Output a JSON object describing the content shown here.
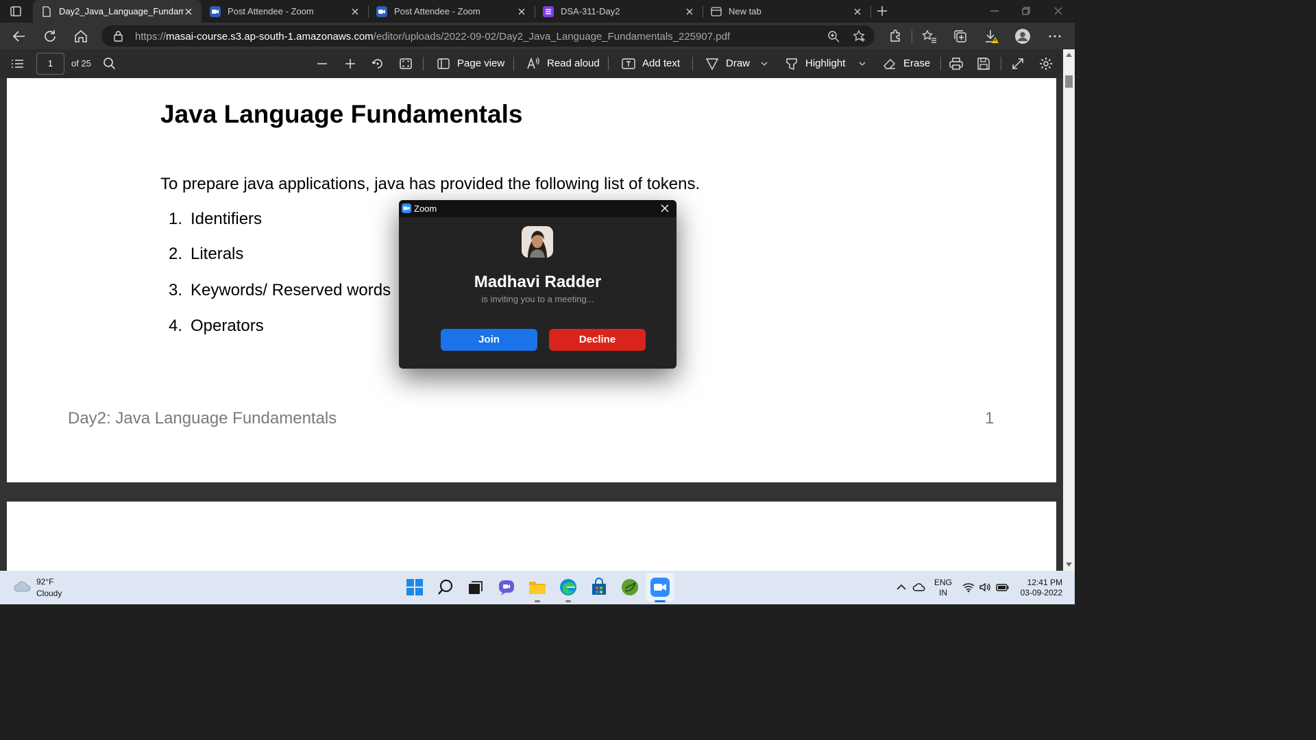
{
  "browser": {
    "tabs": [
      {
        "title": "Day2_Java_Language_Fundamentals_225907.pdf",
        "active": true,
        "icon": "document-icon"
      },
      {
        "title": "Post Attendee - Zoom",
        "active": false,
        "icon": "zoom-icon"
      },
      {
        "title": "Post Attendee - Zoom",
        "active": false,
        "icon": "zoom-icon"
      },
      {
        "title": "DSA-311-Day2",
        "active": false,
        "icon": "list-icon"
      },
      {
        "title": "New tab",
        "active": false,
        "icon": "newtab-icon"
      }
    ],
    "url_prefix": "https://",
    "url_host": "masai-course.s3.ap-south-1.amazonaws.com",
    "url_path": "/editor/uploads/2022-09-02/Day2_Java_Language_Fundamentals_225907.pdf"
  },
  "pdf_toolbar": {
    "page_number": "1",
    "page_total": "of 25",
    "page_view": "Page view",
    "read_aloud": "Read aloud",
    "add_text": "Add text",
    "draw": "Draw",
    "highlight": "Highlight",
    "erase": "Erase"
  },
  "document": {
    "title": "Java Language Fundamentals",
    "intro": "To prepare java applications, java has provided the following list of tokens.",
    "list": [
      {
        "num": "1.",
        "text": "Identifiers"
      },
      {
        "num": "2.",
        "text": "Literals"
      },
      {
        "num": "3.",
        "text": "Keywords/ Reserved words"
      },
      {
        "num": "4.",
        "text": "Operators"
      }
    ],
    "footer_title": "Day2: Java Language Fundamentals",
    "footer_page": "1"
  },
  "zoom_dialog": {
    "title": "Zoom",
    "caller_name": "Madhavi Radder",
    "message": "is inviting you to a meeting...",
    "join_label": "Join",
    "decline_label": "Decline",
    "join_color": "#1a73e8",
    "decline_color": "#d9241b"
  },
  "taskbar": {
    "weather_temp": "92°F",
    "weather_desc": "Cloudy",
    "lang_line1": "ENG",
    "lang_line2": "IN",
    "time": "12:41 PM",
    "date": "03-09-2022"
  }
}
